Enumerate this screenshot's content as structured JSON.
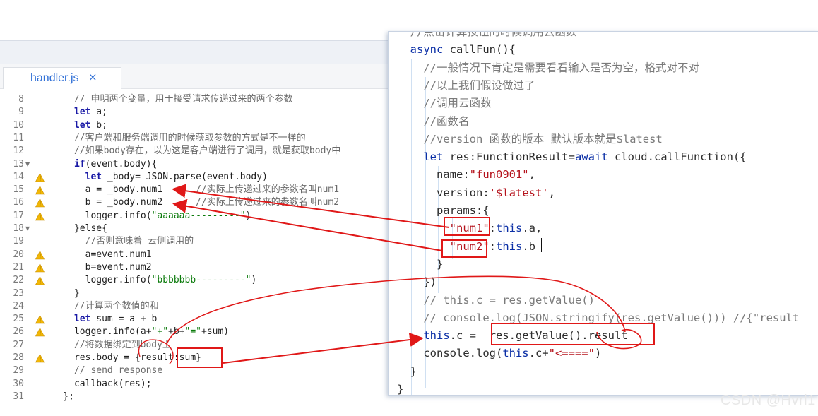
{
  "tab": {
    "filename": "handler.js",
    "close": "×"
  },
  "left_editor": {
    "lines": [
      {
        "n": "8",
        "text": "      // 申明两个变量，用于接受请求传递过来的两个参数"
      },
      {
        "n": "9",
        "text": "      let a;"
      },
      {
        "n": "10",
        "text": "      let b;"
      },
      {
        "n": "11",
        "text": "      //客户端和服务端调用的时候获取参数的方式是不一样的"
      },
      {
        "n": "12",
        "text": "      //如果body存在，以为这是客户端进行了调用，就是获取body中"
      },
      {
        "n": "13",
        "text": "      if(event.body){"
      },
      {
        "n": "14",
        "text": "        let _body= JSON.parse(event.body)"
      },
      {
        "n": "15",
        "text": "        a = _body.num1      //实际上传递过来的参数名叫num1"
      },
      {
        "n": "16",
        "text": "        b = _body.num2      //实际上传递过来的参数名叫num2"
      },
      {
        "n": "17",
        "text": "        logger.info(\"aaaaaa---------\")"
      },
      {
        "n": "18",
        "text": "      }else{"
      },
      {
        "n": "19",
        "text": "        //否则意味着 云侧调用的"
      },
      {
        "n": "20",
        "text": "        a=event.num1"
      },
      {
        "n": "21",
        "text": "        b=event.num2"
      },
      {
        "n": "22",
        "text": "        logger.info(\"bbbbbbb---------\")"
      },
      {
        "n": "23",
        "text": "      }"
      },
      {
        "n": "24",
        "text": "      //计算两个数值的和"
      },
      {
        "n": "25",
        "text": "      let sum = a + b"
      },
      {
        "n": "26",
        "text": "      logger.info(a+\"+\"+b+\"=\"+sum)"
      },
      {
        "n": "27",
        "text": "      //将数据绑定到body上"
      },
      {
        "n": "28",
        "text": "      res.body = {result:sum}"
      },
      {
        "n": "29",
        "text": "      // send response"
      },
      {
        "n": "30",
        "text": "      callback(res);"
      },
      {
        "n": "31",
        "text": "    };"
      }
    ]
  },
  "right_panel": {
    "lines": [
      "  //点击计算按钮的时候调用云函数",
      "  async callFun(){",
      "    //一般情况下肯定是需要看看输入是否为空，格式对不对",
      "    //以上我们假设做过了",
      "    //调用云函数",
      "    //函数名",
      "    //version 函数的版本 默认版本就是$latest",
      "    let res:FunctionResult=await cloud.callFunction({",
      "      name:\"fun0901\",",
      "      version:'$latest',",
      "      params:{",
      "        \"num1\":this.a,",
      "        \"num2\":this.b",
      "      }",
      "    })",
      "    // this.c = res.getValue()",
      "    // console.log(JSON.stringify(res.getValue())) //{\"result",
      "    this.c =  res.getValue().result",
      "    console.log(this.c+\"<====\")",
      "  }",
      "}"
    ]
  },
  "watermark": "CSDN @Hvrl1",
  "colors": {
    "annotation_red": "#e01818",
    "tab_blue": "#2f6fd6",
    "warning_yellow": "#f2b705"
  }
}
